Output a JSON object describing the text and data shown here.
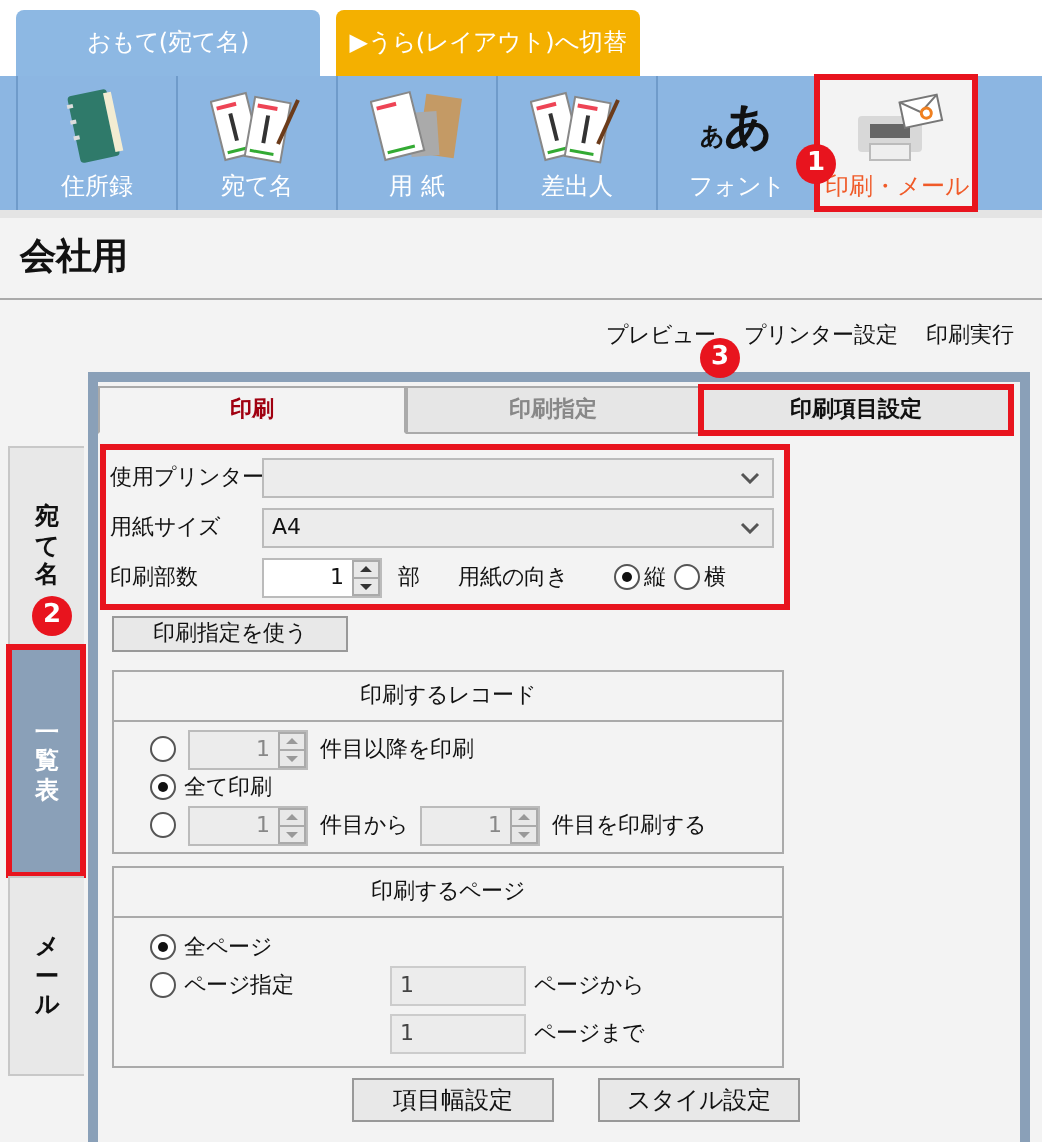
{
  "top_tabs": [
    {
      "label": "おもて(宛て名)",
      "kind": "face"
    },
    {
      "label": "▶うら(レイアウト)へ切替",
      "kind": "switch"
    }
  ],
  "toolbar": [
    {
      "label": "住所録",
      "kind": "image",
      "selected": false
    },
    {
      "label": "宛て名",
      "kind": "image",
      "selected": false
    },
    {
      "label": "用 紙",
      "kind": "image",
      "selected": false
    },
    {
      "label": "差出人",
      "kind": "image",
      "selected": false
    },
    {
      "label": "フォント",
      "kind": "glyph",
      "glyph_small": "あ",
      "glyph_large": "あ",
      "selected": false
    },
    {
      "label": "印刷・メール",
      "kind": "image",
      "selected": true,
      "highlighted": true,
      "badge": "1"
    }
  ],
  "title": "会社用",
  "actions": [
    "プレビュー",
    "プリンター設定",
    "印刷実行"
  ],
  "side_tabs": [
    {
      "label": "宛て名",
      "selected": false
    },
    {
      "label": "一覧表",
      "selected": true,
      "highlighted": true,
      "badge": "2"
    },
    {
      "label": "メール",
      "selected": false
    }
  ],
  "inner_tabs": [
    {
      "label": "印刷",
      "selected": true,
      "disabled": false
    },
    {
      "label": "印刷指定",
      "selected": false,
      "disabled": true
    },
    {
      "label": "印刷項目設定",
      "selected": false,
      "disabled": false,
      "highlighted": true,
      "badge": "3"
    }
  ],
  "print_settings": {
    "highlighted": true,
    "printer": {
      "label": "使用プリンター"
    },
    "paper_size": {
      "label": "用紙サイズ",
      "value": "A4"
    },
    "copies": {
      "label": "印刷部数",
      "value": "1",
      "unit": "部"
    },
    "orientation": {
      "label": "用紙の向き",
      "options": [
        {
          "label": "縦",
          "selected": true
        },
        {
          "label": "横",
          "selected": false
        }
      ]
    }
  },
  "use_settings_button": "印刷指定を使う",
  "records": {
    "title": "印刷するレコード",
    "options": [
      {
        "selected": false,
        "parts": [
          {
            "kind": "spin",
            "value": "1",
            "disabled": true
          },
          {
            "kind": "text",
            "text": "件目以降を印刷"
          }
        ]
      },
      {
        "selected": true,
        "parts": [
          {
            "kind": "text",
            "text": "全て印刷"
          }
        ]
      },
      {
        "selected": false,
        "parts": [
          {
            "kind": "spin",
            "value": "1",
            "disabled": true
          },
          {
            "kind": "text",
            "text": "件目から"
          },
          {
            "kind": "spin",
            "value": "1",
            "disabled": true
          },
          {
            "kind": "text",
            "text": "件目を印刷する"
          }
        ]
      }
    ]
  },
  "pages": {
    "title": "印刷するページ",
    "options": [
      {
        "label": "全ページ",
        "selected": true
      },
      {
        "label": "ページ指定",
        "selected": false
      }
    ],
    "fields": [
      {
        "value": "1",
        "suffix": "ページから",
        "disabled": true
      },
      {
        "value": "1",
        "suffix": "ページまで",
        "disabled": true
      }
    ]
  },
  "bottom_buttons": [
    "項目幅設定",
    "スタイル設定"
  ]
}
